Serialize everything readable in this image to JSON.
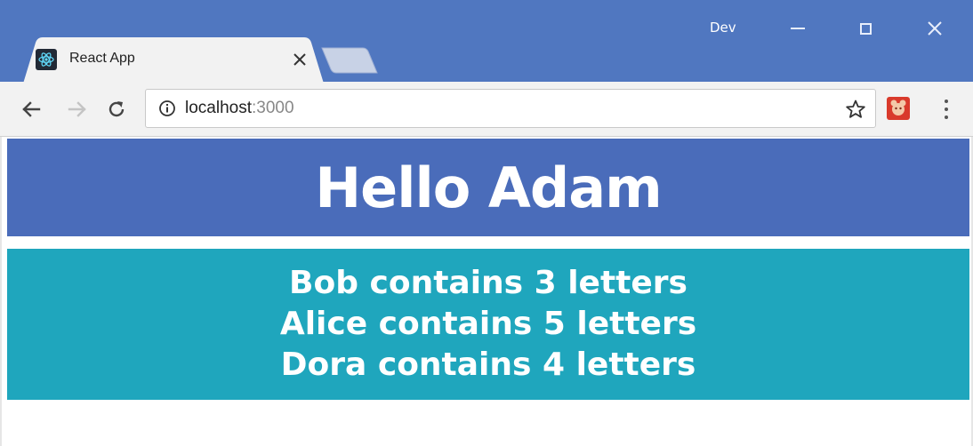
{
  "window": {
    "profile": "Dev"
  },
  "tab": {
    "title": "React App"
  },
  "address_bar": {
    "host": "localhost",
    "port": ":3000"
  },
  "page": {
    "heading": "Hello Adam",
    "items": [
      "Bob contains 3 letters",
      "Alice contains 5 letters",
      "Dora contains 4 letters"
    ]
  },
  "colors": {
    "titlebar": "#5077c0",
    "heading_bg": "#4a6cba",
    "list_bg": "#1fa6bd",
    "text_on_color": "#ffffff"
  },
  "icons": {
    "favicon": "react-logo-icon",
    "back": "arrow-left-icon",
    "forward": "arrow-right-icon",
    "reload": "reload-icon",
    "info": "info-icon",
    "bookmark": "star-icon",
    "extension": "extension-icon",
    "menu": "kebab-menu-icon"
  }
}
